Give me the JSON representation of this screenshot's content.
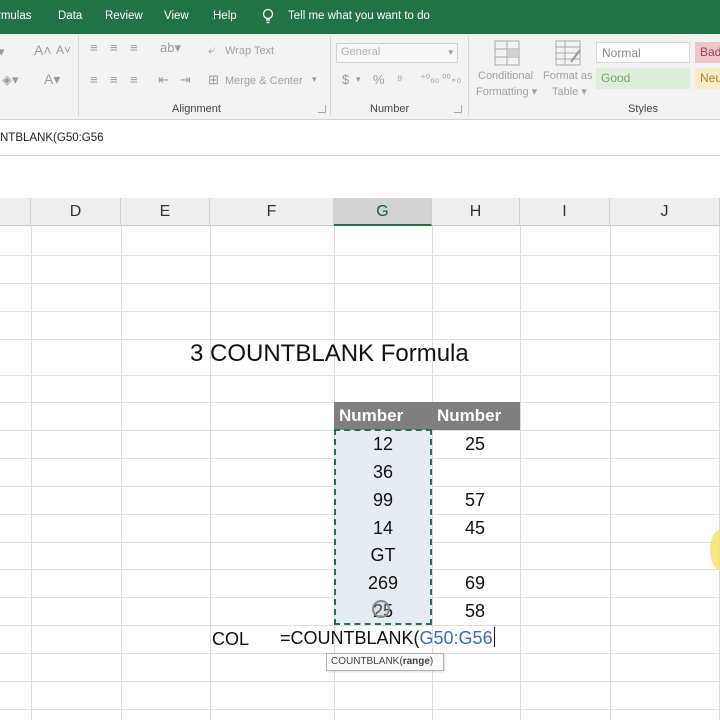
{
  "menu": {
    "formulas": "rmulas",
    "data": "Data",
    "review": "Review",
    "view": "View",
    "help": "Help",
    "tell_me": "Tell me what you want to do"
  },
  "ribbon": {
    "wrap_text": "Wrap Text",
    "merge_center": "Merge & Center",
    "alignment_label": "Alignment",
    "number_format": "General",
    "number_label": "Number",
    "currency": "$",
    "percent": "%",
    "comma": "⁹",
    "conditional_formatting": [
      "Conditional",
      "Formatting"
    ],
    "format_as_table": [
      "Format as",
      "Table"
    ],
    "styles": {
      "normal": "Normal",
      "bad": "Bad",
      "good": "Good",
      "neutral": "Neu"
    },
    "styles_label": "Styles"
  },
  "formula_bar": {
    "text": "NTBLANK(G50:G56"
  },
  "columns": [
    "D",
    "E",
    "F",
    "G",
    "H",
    "I",
    "J"
  ],
  "selected_column": "G",
  "sheet": {
    "title": "3 COUNTBLANK Formula",
    "header_g": "Number",
    "header_h": "Number",
    "col_g": [
      "12",
      "36",
      "99",
      "14",
      "GT",
      "269",
      "25"
    ],
    "col_h": [
      "25",
      "",
      "57",
      "45",
      "",
      "69",
      "58"
    ],
    "label_cell": "COL",
    "formula_prefix": "=COUNTBLANK(",
    "formula_ref": "G50:G56",
    "tooltip_fn": "COUNTBLANK(",
    "tooltip_arg": "range",
    "tooltip_end": ")"
  },
  "colors": {
    "excel_green": "#217346",
    "header_fill": "#7f7f7f",
    "selection_fill": "#e7ecf3",
    "ref_blue": "#3a6fb0"
  }
}
